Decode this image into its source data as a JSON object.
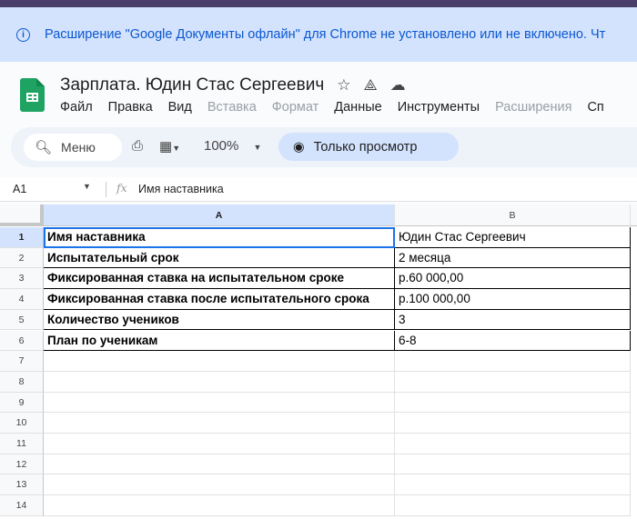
{
  "banner": {
    "text": "Расширение \"Google Документы офлайн\" для Chrome не установлено или не включено. Чт"
  },
  "doc": {
    "title": "Зарплата. Юдин Стас Сергеевич"
  },
  "menu": [
    {
      "label": "Файл",
      "disabled": false
    },
    {
      "label": "Правка",
      "disabled": false
    },
    {
      "label": "Вид",
      "disabled": false
    },
    {
      "label": "Вставка",
      "disabled": true
    },
    {
      "label": "Формат",
      "disabled": true
    },
    {
      "label": "Данные",
      "disabled": false
    },
    {
      "label": "Инструменты",
      "disabled": false
    },
    {
      "label": "Расширения",
      "disabled": true
    },
    {
      "label": "Сп",
      "disabled": false
    }
  ],
  "toolbar": {
    "search_placeholder": "Меню",
    "zoom": "100%",
    "view_only": "Только просмотр"
  },
  "formula": {
    "ref": "A1",
    "value": "Имя наставника"
  },
  "columns": [
    "A",
    "B"
  ],
  "rows": [
    {
      "n": "1",
      "a": "Имя наставника",
      "b": "Юдин Стас Сергеевич"
    },
    {
      "n": "2",
      "a": "Испытательный срок",
      "b": "2 месяца"
    },
    {
      "n": "3",
      "a": "Фиксированная ставка на испытательном сроке",
      "b": "р.60 000,00"
    },
    {
      "n": "4",
      "a": "Фиксированная ставка после испытательного срока",
      "b": "р.100 000,00"
    },
    {
      "n": "5",
      "a": "Количество учеников",
      "b": "3"
    },
    {
      "n": "6",
      "a": "План по ученикам",
      "b": "6-8"
    },
    {
      "n": "7",
      "a": "",
      "b": ""
    },
    {
      "n": "8",
      "a": "",
      "b": ""
    },
    {
      "n": "9",
      "a": "",
      "b": ""
    },
    {
      "n": "10",
      "a": "",
      "b": ""
    },
    {
      "n": "11",
      "a": "",
      "b": ""
    },
    {
      "n": "12",
      "a": "",
      "b": ""
    },
    {
      "n": "13",
      "a": "",
      "b": ""
    },
    {
      "n": "14",
      "a": "",
      "b": ""
    }
  ]
}
